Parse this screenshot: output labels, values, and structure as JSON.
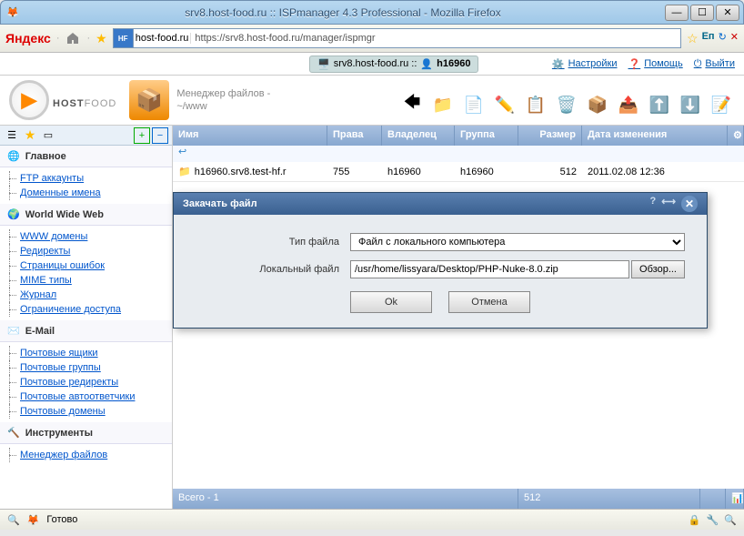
{
  "window": {
    "title": "srv8.host-food.ru :: ISPmanager 4.3 Professional - Mozilla Firefox"
  },
  "nav": {
    "yandex": "Яндекс",
    "favicon_label": "HF",
    "domain": "host-food.ru",
    "url": "https://srv8.host-food.ru/manager/ispmgr"
  },
  "topbar": {
    "server": "srv8.host-food.ru ::",
    "user": "h16960",
    "settings": "Настройки",
    "help": "Помощь",
    "exit": "Выйти"
  },
  "logo": {
    "host": "HOST",
    "food": "FOOD"
  },
  "filemanager": {
    "title_line1": "Менеджер файлов -",
    "title_line2": "~/www"
  },
  "columns": {
    "name": "Имя",
    "perms": "Права",
    "owner": "Владелец",
    "group": "Группа",
    "size": "Размер",
    "date": "Дата изменения"
  },
  "rows": [
    {
      "name": "h16960.srv8.test-hf.r",
      "perms": "755",
      "owner": "h16960",
      "group": "h16960",
      "size": "512",
      "date": "2011.02.08 12:36"
    }
  ],
  "status": {
    "total": "Всего - 1",
    "size": "512"
  },
  "sidebar": {
    "sections": [
      {
        "icon": "globe",
        "title": "Главное",
        "items": [
          "FTP аккаунты",
          "Доменные имена"
        ]
      },
      {
        "icon": "www",
        "title": "World Wide Web",
        "items": [
          "WWW домены",
          "Редиректы",
          "Страницы ошибок",
          "MIME типы",
          "Журнал",
          "Ограничение доступа"
        ]
      },
      {
        "icon": "mail",
        "title": "E-Mail",
        "items": [
          "Почтовые ящики",
          "Почтовые группы",
          "Почтовые редиректы",
          "Почтовые автоответчики",
          "Почтовые домены"
        ]
      },
      {
        "icon": "tools",
        "title": "Инструменты",
        "items": [
          "Менеджер файлов"
        ]
      }
    ]
  },
  "modal": {
    "title": "Закачать файл",
    "type_label": "Тип файла",
    "type_value": "Файл с локального компьютера",
    "file_label": "Локальный файл",
    "file_value": "/usr/home/lissyara/Desktop/PHP-Nuke-8.0.zip",
    "browse": "Обзор...",
    "ok": "Ok",
    "cancel": "Отмена"
  },
  "footer": {
    "status": "Готово"
  }
}
